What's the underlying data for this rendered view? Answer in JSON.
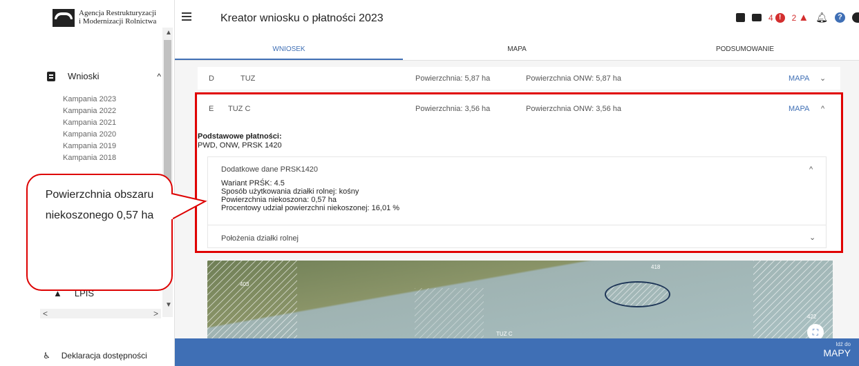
{
  "sidebar": {
    "logo_line1": "Agencja Restrukturyzacji",
    "logo_line2": "i Modernizacji Rolnictwa",
    "nav_label": "Wnioski",
    "campaigns": [
      "Kampania 2023",
      "Kampania 2022",
      "Kampania 2021",
      "Kampania 2020",
      "Kampania 2019",
      "Kampania 2018"
    ],
    "lpis_label": "LPIS",
    "accessibility_label": "Deklaracja dostępności"
  },
  "header": {
    "title": "Kreator wniosku o płatności 2023",
    "error_count": "4",
    "warning_count": "2"
  },
  "tabs": [
    "WNIOSEK",
    "MAPA",
    "PODSUMOWANIE"
  ],
  "rows": {
    "d": {
      "letter": "D",
      "name": "TUZ",
      "area": "Powierzchnia: 5,87 ha",
      "onw": "Powierzchnia ONW: 5,87 ha",
      "map": "MAPA"
    },
    "e": {
      "letter": "E",
      "name": "TUZ C",
      "area": "Powierzchnia: 3,56 ha",
      "onw": "Powierzchnia ONW: 3,56 ha",
      "map": "MAPA"
    }
  },
  "payments": {
    "heading": "Podstawowe płatności:",
    "list": "PWD, ONW, PRSK 1420"
  },
  "extra": {
    "heading": "Dodatkowe dane PRSK1420",
    "variant": "Wariant PRŚK: 4.5",
    "usage": "Sposób użytkowania działki rolnej: kośny",
    "uncut_area": "Powierzchnia niekoszona: 0,57 ha",
    "uncut_percent": "Procentowy udział powierzchni niekoszonej: 16,01 %"
  },
  "location": {
    "heading": "Położenia działki rolnej"
  },
  "map": {
    "label_403": "403",
    "label_418": "418",
    "label_422": "422",
    "parcel_label": "TUZ C"
  },
  "bottom": {
    "goto_small": "Idź do",
    "goto_big": "MAPY"
  },
  "callout": {
    "text": "Powierzchnia obszaru niekoszonego 0,57 ha"
  },
  "colors": {
    "accent": "#3f6fb5",
    "highlight": "#e00000",
    "error": "#d32f2f"
  }
}
